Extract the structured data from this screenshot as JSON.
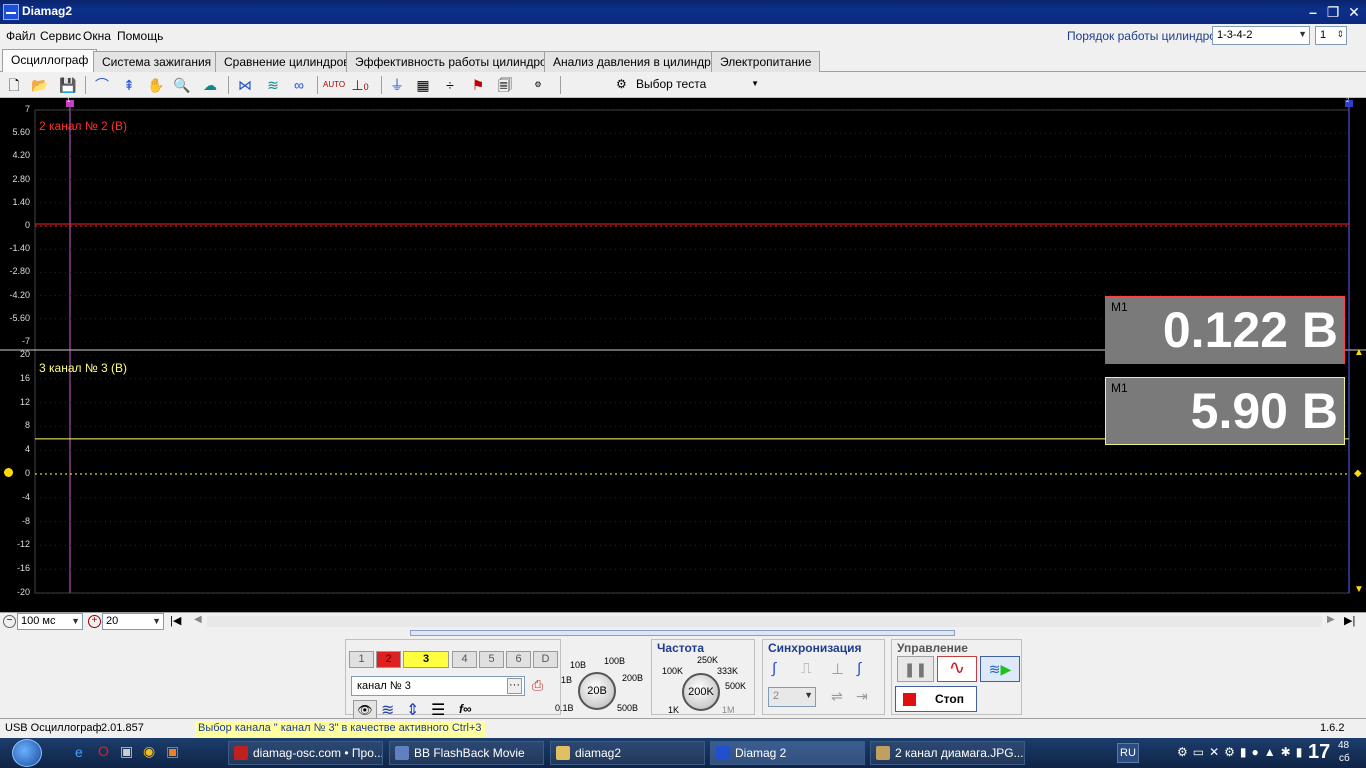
{
  "window": {
    "title": "Diamag2"
  },
  "menu": [
    "Файл",
    "Сервис",
    "Окна",
    "Помощь"
  ],
  "cylinder": {
    "label": "Порядок работы цилиндров",
    "order": "1-3-4-2",
    "number": "1"
  },
  "tabs": [
    "Осциллограф",
    "Система зажигания",
    "Сравнение цилиндров",
    "Эффективность работы цилиндров",
    "Анализ давления в цилиндре",
    "Электропитание"
  ],
  "toolbar": {
    "test_select": "Выбор теста",
    "auto1": "AUTO",
    "auto_zero": "0"
  },
  "chart_data": [
    {
      "type": "line",
      "title": "2 канал № 2 (В)",
      "y_ticks": [
        "7",
        "5.60",
        "4.20",
        "2.80",
        "1.40",
        "0",
        "-1.40",
        "-2.80",
        "-4.20",
        "-5.60",
        "-7"
      ],
      "ylim": [
        -7,
        7
      ],
      "series": [
        {
          "values": [
            0.122
          ]
        }
      ],
      "measurement": {
        "label": "M1",
        "value": "0.122 В"
      },
      "color": "#ff2020"
    },
    {
      "type": "line",
      "title": "3 канал № 3 (В)",
      "y_ticks": [
        "20",
        "16",
        "12",
        "8",
        "4",
        "0",
        "-4",
        "-8",
        "-12",
        "-16",
        "-20"
      ],
      "ylim": [
        -20,
        20
      ],
      "series": [
        {
          "values": [
            5.9
          ]
        }
      ],
      "measurement": {
        "label": "M1",
        "value": "5.90 В"
      },
      "color": "#ffff66"
    }
  ],
  "markers": {
    "cursor1": "1",
    "cursor2": "2"
  },
  "timebase": {
    "value": "100 мс",
    "zoom": "20"
  },
  "channels": [
    "1",
    "2",
    "3",
    "4",
    "5",
    "6",
    "D"
  ],
  "active_channel": "канал № 3",
  "amplitude_knob": {
    "value": "20В",
    "ticks": [
      "10В",
      "100В",
      "1В",
      "200В",
      "0.1В",
      "500В"
    ]
  },
  "frequency": {
    "title": "Частота",
    "value": "200K",
    "ticks": [
      "250K",
      "100K",
      "333K",
      "500K",
      "1K",
      "1M"
    ]
  },
  "sync": {
    "title": "Синхронизация",
    "value": "2"
  },
  "control": {
    "title": "Управление",
    "stop": "Стоп"
  },
  "status": {
    "device": "USB Осциллограф",
    "version": "2.01.857",
    "message": "Выбор канала \" канал № 3\" в качестве активного Ctrl+3",
    "app_version": "1.6.2"
  },
  "taskbar": {
    "items": [
      "diamag-osc.com • Про...",
      "BB FlashBack Movie",
      "diamag2",
      "Diamag 2",
      "2 канал диамага.JPG..."
    ],
    "lang": "RU",
    "time_h": "17",
    "time_m": "48",
    "day": "сб"
  }
}
